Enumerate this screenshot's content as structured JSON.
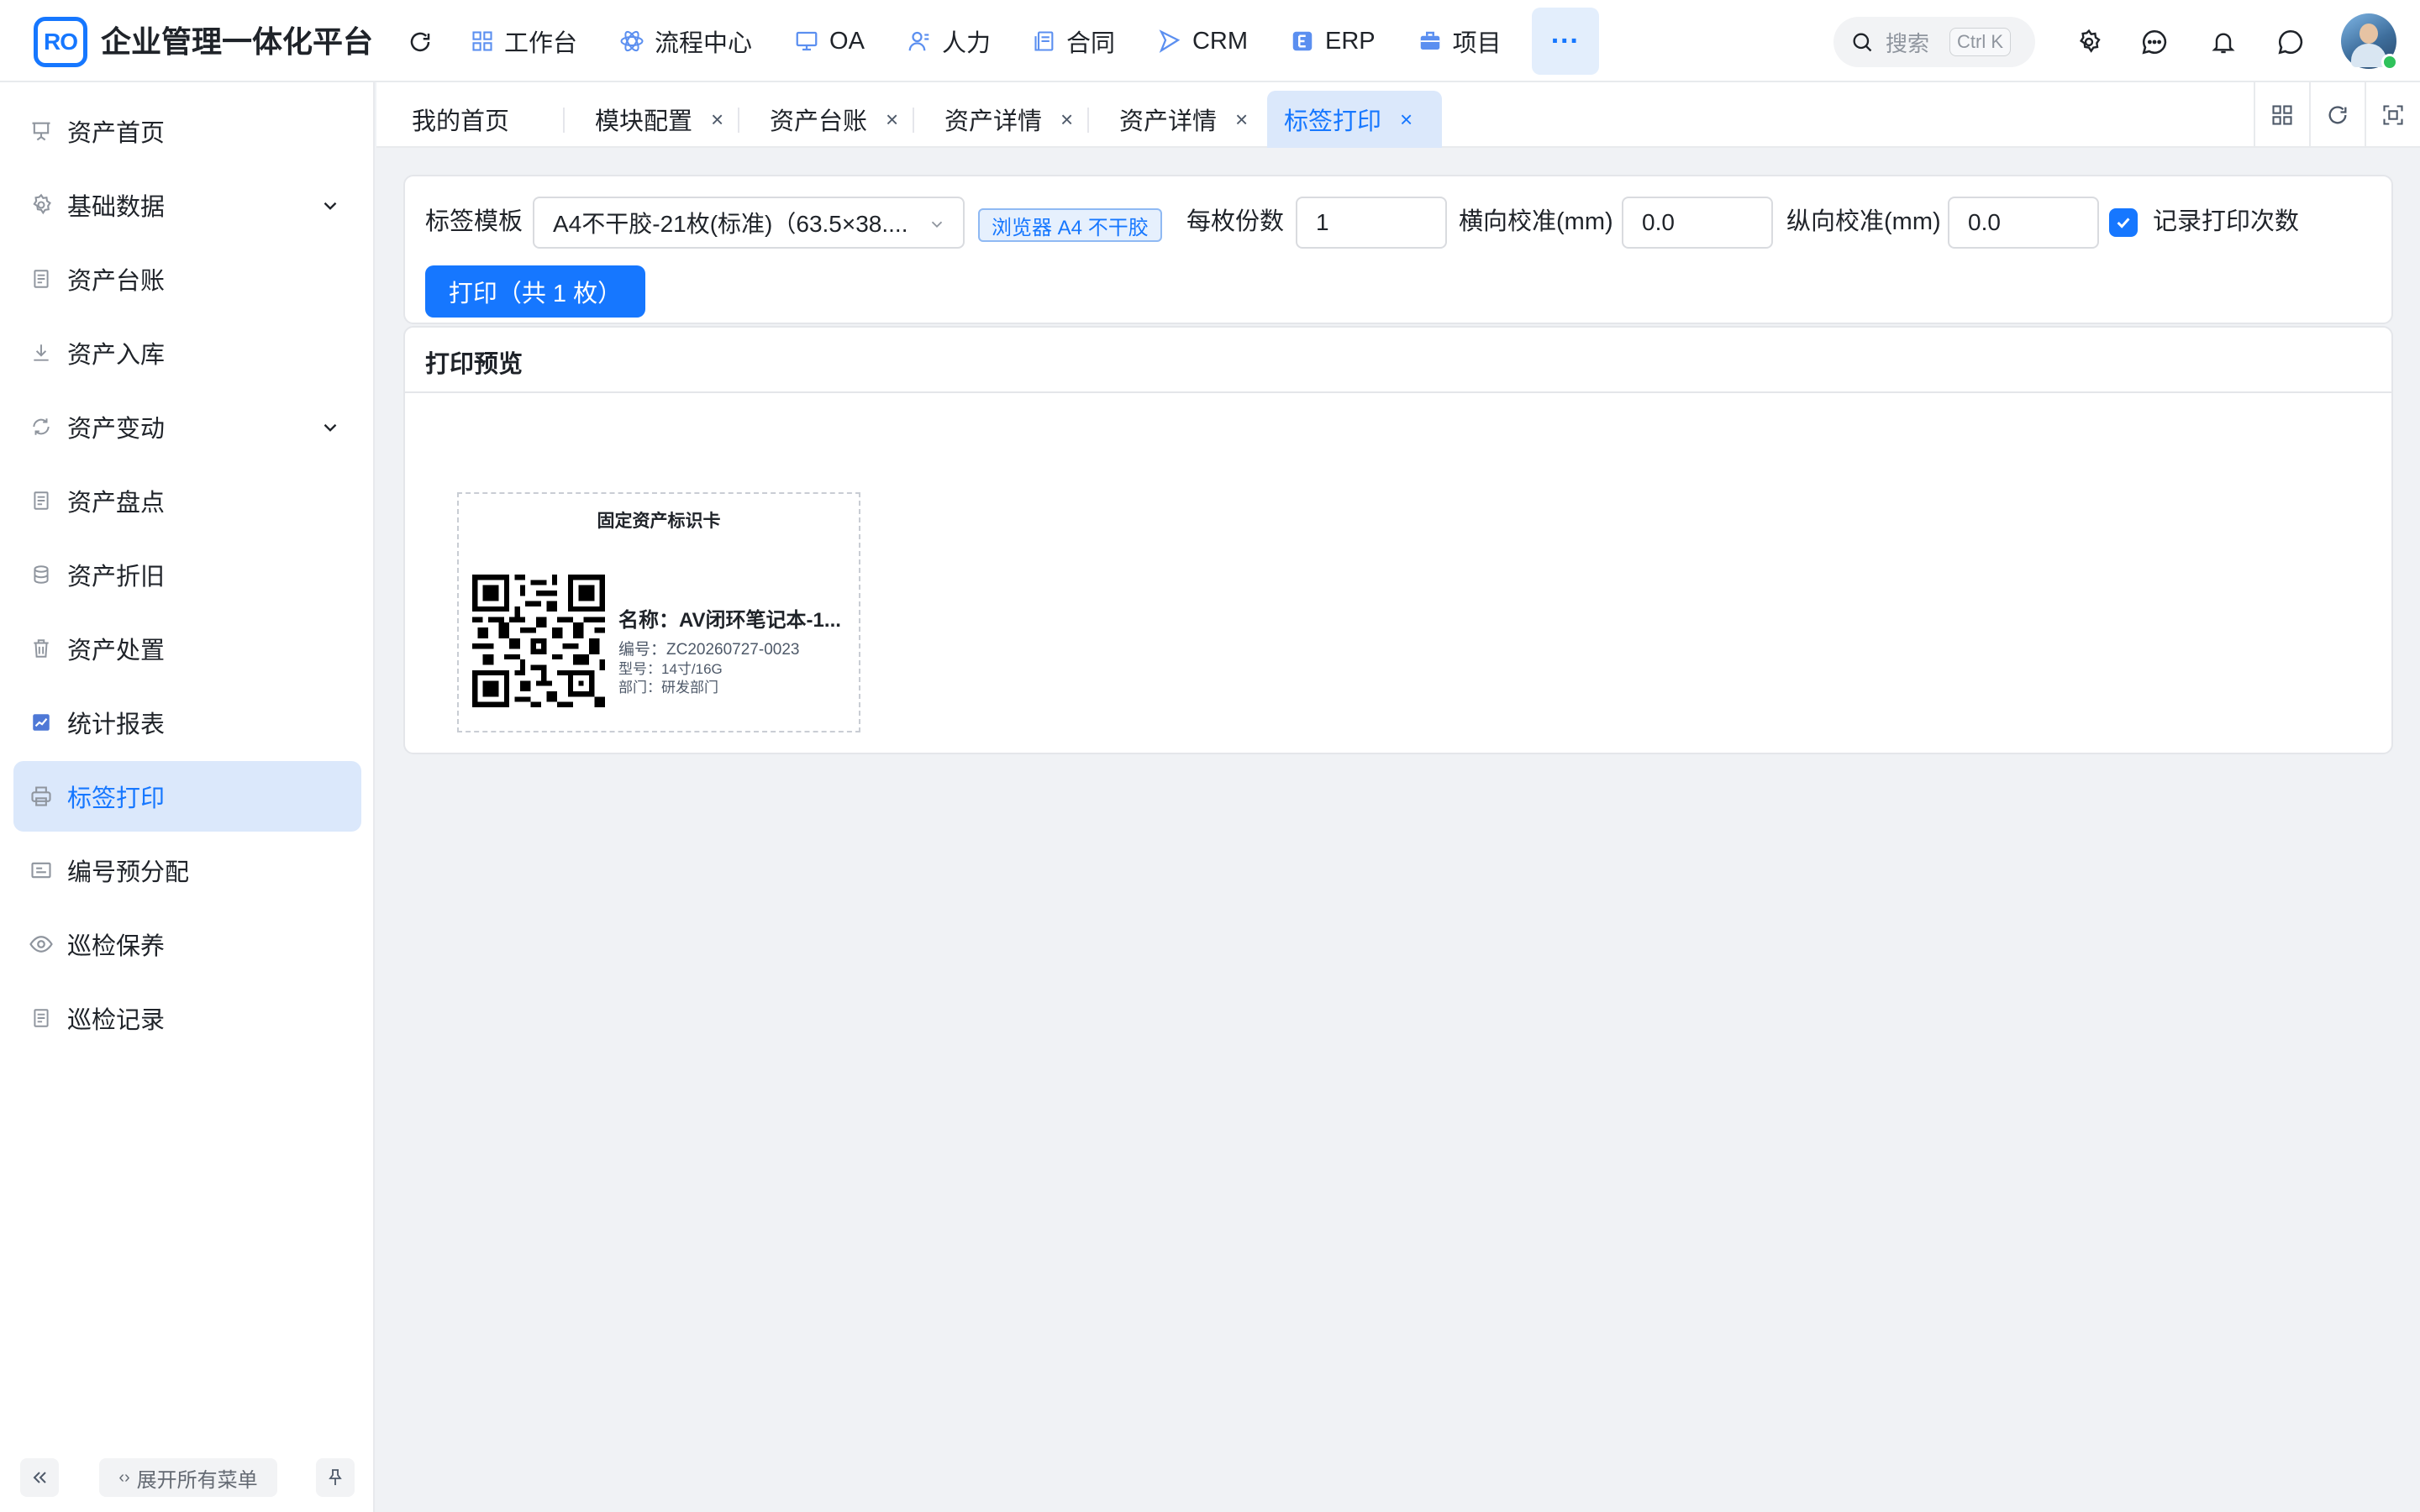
{
  "app": {
    "logo_text": "RO",
    "title": "企业管理一体化平台"
  },
  "topnav": {
    "items": [
      {
        "label": "工作台",
        "icon": "grid-icon"
      },
      {
        "label": "流程中心",
        "icon": "workflow-icon"
      },
      {
        "label": "OA",
        "icon": "monitor-icon"
      },
      {
        "label": "人力",
        "icon": "user-icon"
      },
      {
        "label": "合同",
        "icon": "contract-icon"
      },
      {
        "label": "CRM",
        "icon": "crm-icon"
      },
      {
        "label": "ERP",
        "icon": "erp-icon"
      },
      {
        "label": "项目",
        "icon": "briefcase-icon"
      }
    ],
    "more_label": "···"
  },
  "search": {
    "placeholder": "搜索",
    "shortcut": "Ctrl K"
  },
  "sidebar": {
    "items": [
      {
        "label": "资产首页",
        "icon": "presentation-icon"
      },
      {
        "label": "基础数据",
        "icon": "gear-icon",
        "expandable": true
      },
      {
        "label": "资产台账",
        "icon": "document-icon"
      },
      {
        "label": "资产入库",
        "icon": "download-icon"
      },
      {
        "label": "资产变动",
        "icon": "sync-icon",
        "expandable": true
      },
      {
        "label": "资产盘点",
        "icon": "document-icon"
      },
      {
        "label": "资产折旧",
        "icon": "database-icon"
      },
      {
        "label": "资产处置",
        "icon": "trash-icon"
      },
      {
        "label": "统计报表",
        "icon": "chart-icon"
      },
      {
        "label": "标签打印",
        "icon": "printer-icon",
        "active": true
      },
      {
        "label": "编号预分配",
        "icon": "id-card-icon"
      },
      {
        "label": "巡检保养",
        "icon": "eye-icon"
      },
      {
        "label": "巡检记录",
        "icon": "document-icon"
      }
    ],
    "expand_all_label": "展开所有菜单",
    "expand_all_icon": "‹›"
  },
  "tabs": [
    {
      "label": "我的首页",
      "closable": false
    },
    {
      "label": "模块配置",
      "closable": true
    },
    {
      "label": "资产台账",
      "closable": true
    },
    {
      "label": "资产详情",
      "closable": true
    },
    {
      "label": "资产详情",
      "closable": true
    },
    {
      "label": "标签打印",
      "closable": true,
      "active": true
    }
  ],
  "tab_close_glyph": "×",
  "form": {
    "template_label": "标签模板",
    "template_value": "A4不干胶-21枚(标准)（63.5×38....",
    "badge": "浏览器 A4 不干胶",
    "copies_label": "每枚份数",
    "copies_value": "1",
    "h_calib_label": "横向校准(mm)",
    "h_calib_value": "0.0",
    "v_calib_label": "纵向校准(mm)",
    "v_calib_value": "0.0",
    "record_label": "记录打印次数",
    "record_checked": true,
    "print_button": "打印（共 1 枚）"
  },
  "preview": {
    "title": "打印预览",
    "label": {
      "title": "固定资产标识卡",
      "name": "名称：AV闭环笔记本-1...",
      "code": "编号：ZC20260727-0023",
      "model": "型号：14寸/16G",
      "dept": "部门：研发部门"
    }
  },
  "colors": {
    "accent": "#1677ff",
    "active_bg": "#dbe8fb",
    "page_bg": "#f0f2f5"
  }
}
